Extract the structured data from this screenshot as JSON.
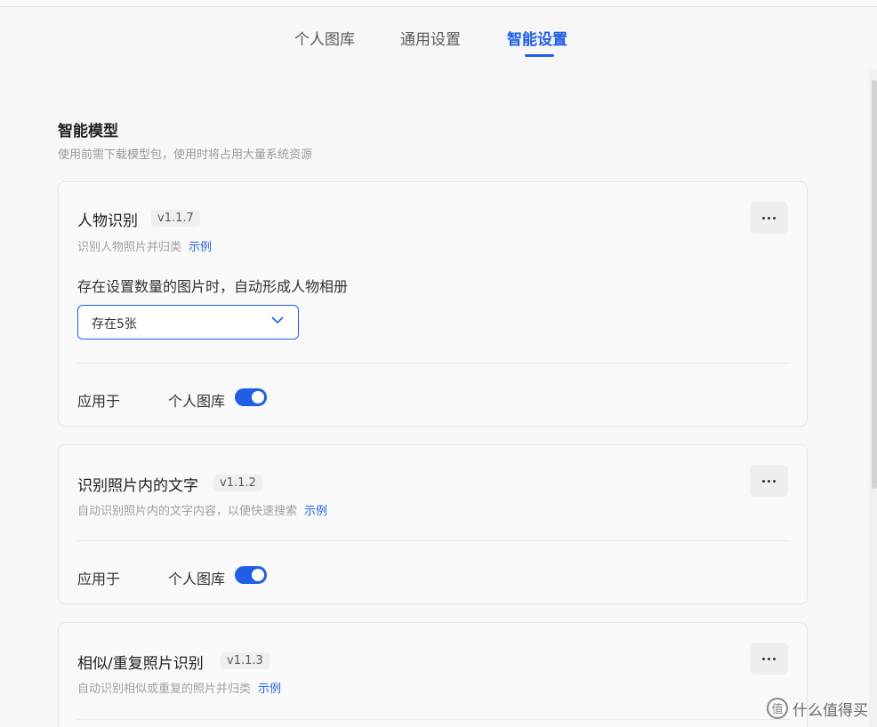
{
  "tabs": [
    {
      "label": "个人图库",
      "active": false
    },
    {
      "label": "通用设置",
      "active": false
    },
    {
      "label": "智能设置",
      "active": true
    }
  ],
  "section": {
    "title": "智能模型",
    "description": "使用前需下载模型包，使用时将占用大量系统资源"
  },
  "cards": [
    {
      "title": "人物识别",
      "version": "v1.1.7",
      "description": "识别人物照片并归类",
      "example": "示例",
      "question": "存在设置数量的图片时，自动形成人物相册",
      "select_value": "存在5张",
      "apply_label": "应用于",
      "apply_target": "个人图库",
      "toggle_on": true
    },
    {
      "title": "识别照片内的文字",
      "version": "v1.1.2",
      "description": "自动识别照片内的文字内容，以便快速搜索",
      "example": "示例",
      "apply_label": "应用于",
      "apply_target": "个人图库",
      "toggle_on": true
    },
    {
      "title": "相似/重复照片识别",
      "version": "v1.1.3",
      "description": "自动识别相似或重复的照片并归类",
      "example": "示例"
    }
  ],
  "watermark": "什么值得买",
  "colors": {
    "accent": "#1f5fe6",
    "background": "#f7f7f8",
    "card_border": "#e3e3e6"
  }
}
